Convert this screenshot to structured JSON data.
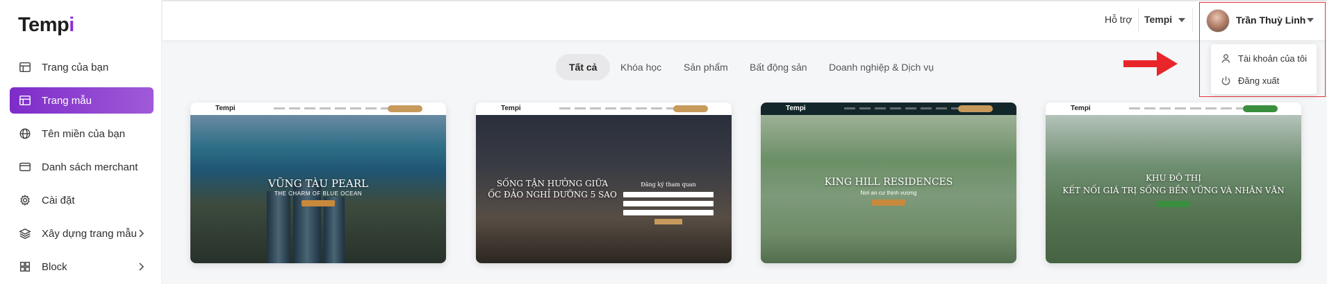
{
  "app": {
    "logo_main": "Temp",
    "logo_accent": "i"
  },
  "sidebar": {
    "items": [
      {
        "label": "Trang của bạn",
        "icon": "layout-icon",
        "active": false
      },
      {
        "label": "Trang mẫu",
        "icon": "layout-icon",
        "active": true
      },
      {
        "label": "Tên miền của bạn",
        "icon": "globe-icon",
        "active": false
      },
      {
        "label": "Danh sách merchant",
        "icon": "card-icon",
        "active": false
      },
      {
        "label": "Cài đặt",
        "icon": "gear-icon",
        "active": false
      },
      {
        "label": "Xây dựng trang mẫu",
        "icon": "layers-icon",
        "active": false,
        "has_submenu": true
      },
      {
        "label": "Block",
        "icon": "grid-icon",
        "active": false,
        "has_submenu": true
      }
    ]
  },
  "topbar": {
    "support_label": "Hỗ trợ",
    "workspace_label": "Tempi",
    "user_name": "Trần Thuỳ Linh",
    "dropdown": [
      {
        "label": "Tài khoản của tôi",
        "icon": "user-icon"
      },
      {
        "label": "Đăng xuất",
        "icon": "power-icon"
      }
    ]
  },
  "tabs": [
    {
      "label": "Tất cả",
      "active": true
    },
    {
      "label": "Khóa học",
      "active": false
    },
    {
      "label": "Sản phẩm",
      "active": false
    },
    {
      "label": "Bất động sản",
      "active": false
    },
    {
      "label": "Doanh nghiệp & Dịch vụ",
      "active": false
    }
  ],
  "templates": [
    {
      "logo": "Tempi",
      "title": "VŨNG TÀU PEARL",
      "subtitle": "THE CHARM OF BLUE OCEAN"
    },
    {
      "logo": "Tempi",
      "title_line1": "SỐNG TẬN HƯỞNG GIỮA",
      "title_line2": "ỐC ĐẢO NGHỈ DƯỠNG 5 SAO",
      "form_title": "Đăng ký tham quan"
    },
    {
      "logo": "Tempi",
      "title": "KING HILL RESIDENCES",
      "subtitle": "Nơi an cư thịnh vượng"
    },
    {
      "logo": "Tempi",
      "title_line1": "KHU ĐÔ THỊ",
      "title_line2": "KẾT NỐI GIÁ TRỊ SỐNG BỀN VỮNG VÀ NHÂN VĂN"
    }
  ],
  "colors": {
    "accent": "#8b2fd6",
    "highlight_border": "#e53238",
    "arrow": "#e8262a"
  }
}
